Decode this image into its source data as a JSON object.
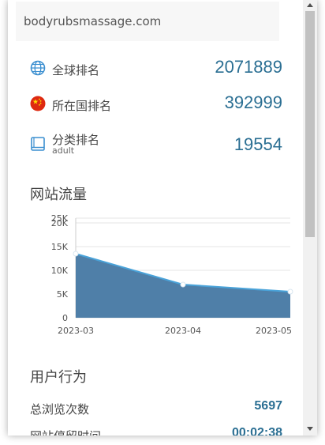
{
  "domain": "bodyrubsmassage.com",
  "ranks": [
    {
      "label": "全球排名",
      "value": "2071889",
      "icon": "globe-icon"
    },
    {
      "label": "所在国排名",
      "value": "392999",
      "icon": "china-flag-icon"
    },
    {
      "label": "分类排名",
      "sublabel": "adult",
      "value": "19554",
      "icon": "book-icon"
    }
  ],
  "traffic": {
    "title": "网站流量"
  },
  "chart_data": {
    "type": "area",
    "x": [
      "2023-03",
      "2023-04",
      "2023-05"
    ],
    "series": [
      {
        "values": [
          13500,
          7000,
          5500
        ]
      }
    ],
    "yticks": [
      "20K",
      "15K",
      "10K",
      "5K",
      "0"
    ],
    "overlay_tick": "25K",
    "ylim": [
      0,
      20000
    ],
    "grid": true,
    "colors": {
      "fill": "#4f7fa8",
      "line": "#4aa3d9"
    }
  },
  "behavior": {
    "title": "用户行为",
    "items": [
      {
        "label": "总浏览次数",
        "value": "5697"
      },
      {
        "label": "网站停留时间",
        "value": "00:02:38"
      }
    ]
  },
  "colors": {
    "accent": "#2b6f93",
    "text": "#444444"
  }
}
